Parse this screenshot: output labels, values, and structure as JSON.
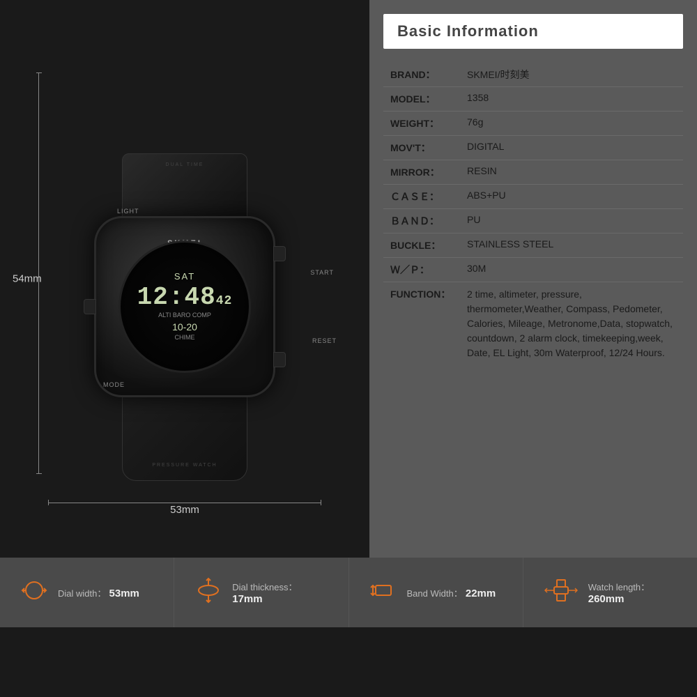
{
  "page": {
    "background": "#1a1a1a"
  },
  "watch": {
    "brand_on_strap": "DUAL TIME",
    "brand_on_case": "SKMEI",
    "pressure_text": "PRESSURE WATCH",
    "day": "SAT",
    "time": "12:48",
    "seconds": "42",
    "date": "10-20",
    "sub_labels": "ALTI  BARO  COMP",
    "chime_label": "CHIME",
    "btn_start": "START",
    "btn_reset": "RESET",
    "btn_light": "LIGHT",
    "btn_mode": "MODE",
    "dim_height": "54mm",
    "dim_width": "53mm"
  },
  "info": {
    "title": "Basic Information",
    "rows": [
      {
        "key": "BRAND：",
        "value": "SKMEI/时刻美"
      },
      {
        "key": "MODEL：",
        "value": "1358"
      },
      {
        "key": "WEIGHT：",
        "value": "76g"
      },
      {
        "key": "MOV'T：",
        "value": "DIGITAL"
      },
      {
        "key": "MIRROR：",
        "value": "RESIN"
      },
      {
        "key": "ＣＡＳＥ：",
        "value": "ABS+PU"
      },
      {
        "key": "ＢＡＮＤ：",
        "value": "PU"
      },
      {
        "key": "BUCKLE：",
        "value": "STAINLESS STEEL"
      },
      {
        "key": "Ｗ／Ｐ：",
        "value": "30M"
      },
      {
        "key": "FUNCTION：",
        "value": "2 time, altimeter, pressure, thermometer,Weather, Compass, Pedometer, Calories, Mileage, Metronome,Data, stopwatch, countdown, 2 alarm clock, timekeeping,week, Date, EL Light, 30m Waterproof, 12/24 Hours."
      }
    ]
  },
  "specs": [
    {
      "icon": "dial-width-icon",
      "label": "Dial width：",
      "value": "53mm"
    },
    {
      "icon": "dial-thickness-icon",
      "label": "Dial thickness：",
      "value": "17mm"
    },
    {
      "icon": "band-width-icon",
      "label": "Band Width：",
      "value": "22mm"
    },
    {
      "icon": "watch-length-icon",
      "label": "Watch length：",
      "value": "260mm"
    }
  ]
}
